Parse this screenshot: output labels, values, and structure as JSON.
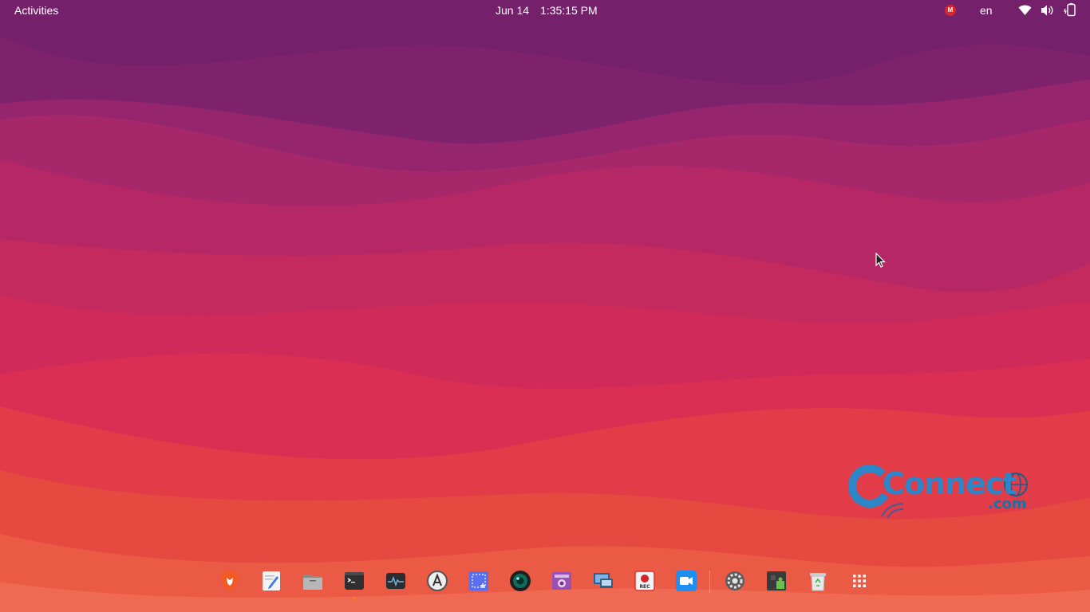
{
  "topbar": {
    "activities_label": "Activities",
    "date": "Jun 14",
    "time": "1:35:15 PM",
    "mega_badge": "M",
    "language": "en",
    "indicators": [
      "wifi-icon",
      "volume-icon",
      "battery-icon"
    ]
  },
  "watermark": {
    "word": "Connect",
    "tld": ".com",
    "globe_text": "www"
  },
  "dock": {
    "apps": [
      {
        "id": "brave",
        "icon": "brave-browser-icon"
      },
      {
        "id": "text-editor",
        "icon": "text-editor-icon"
      },
      {
        "id": "files",
        "icon": "files-folder-icon"
      },
      {
        "id": "terminal",
        "icon": "terminal-icon",
        "running": true
      },
      {
        "id": "system-monitor",
        "icon": "system-monitor-icon"
      },
      {
        "id": "software-updater",
        "icon": "software-updater-icon"
      },
      {
        "id": "screenshot",
        "icon": "screenshot-selection-icon"
      },
      {
        "id": "camera",
        "icon": "camera-lens-icon"
      },
      {
        "id": "photo-app",
        "icon": "photo-viewer-icon"
      },
      {
        "id": "remote-desktop",
        "icon": "remote-desktop-icon"
      },
      {
        "id": "screen-recorder",
        "icon": "screen-recorder-icon",
        "label": "REC"
      },
      {
        "id": "zoom",
        "icon": "video-call-icon"
      },
      {
        "id": "settings",
        "icon": "settings-gear-icon"
      },
      {
        "id": "extensions",
        "icon": "extensions-puzzle-icon"
      },
      {
        "id": "trash",
        "icon": "trash-recycle-icon"
      },
      {
        "id": "show-apps",
        "icon": "app-grid-icon"
      }
    ]
  },
  "colors": {
    "sky_top": "#74206a",
    "mid_band": "#c6285c",
    "bottom_band": "#e4513f",
    "accent_running": "#f27b2c"
  }
}
